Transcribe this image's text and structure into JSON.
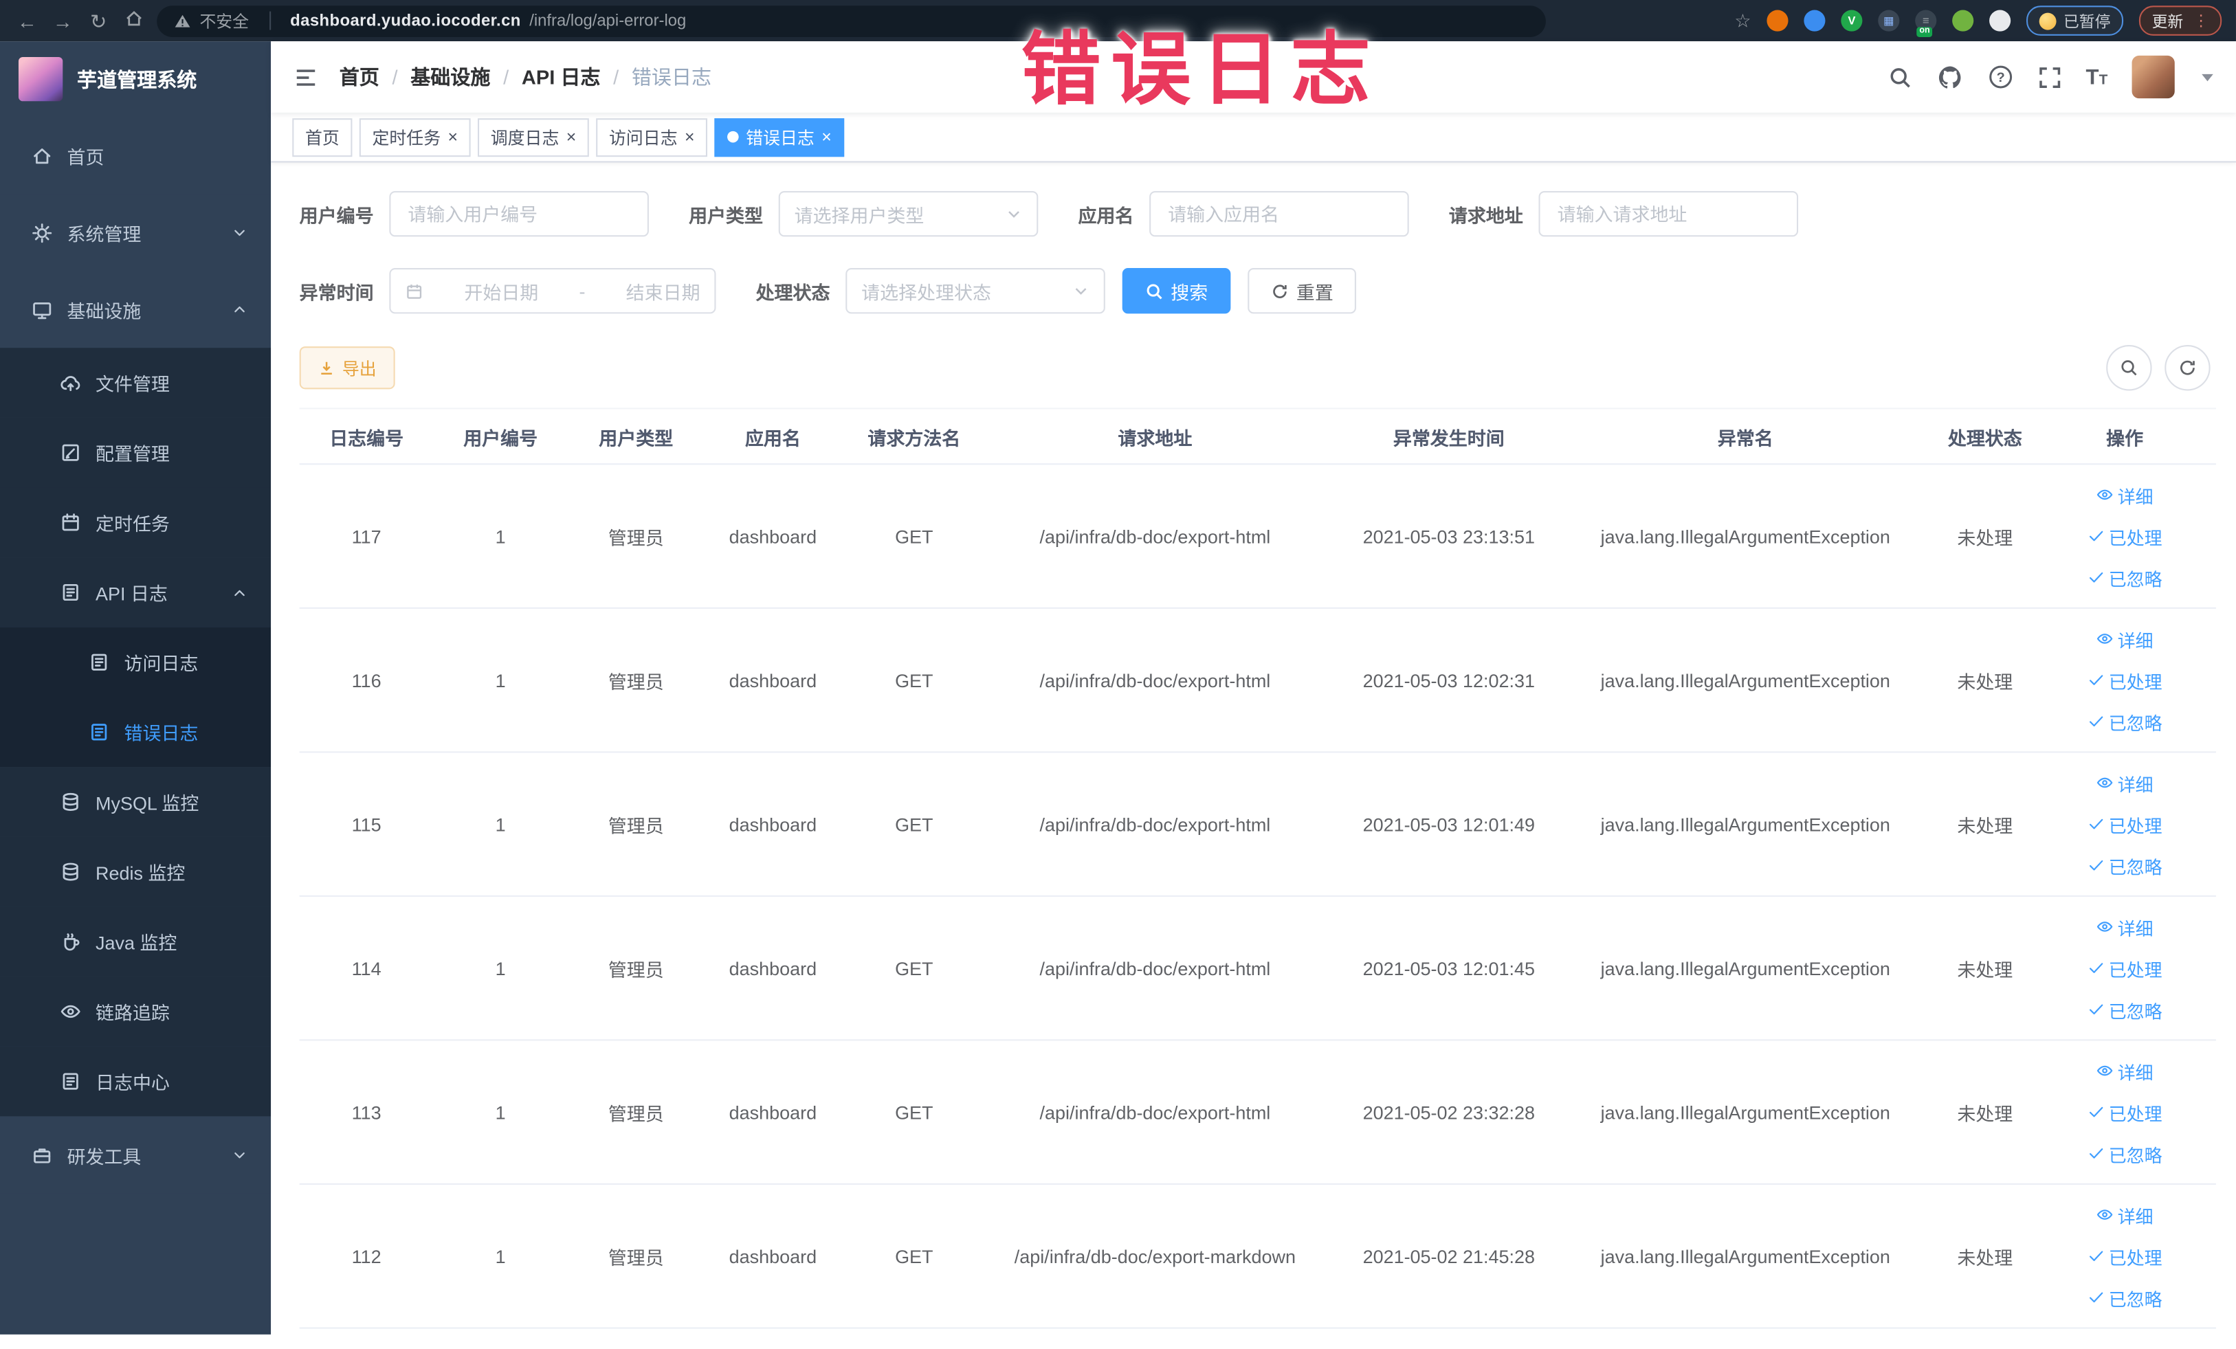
{
  "browser": {
    "security_label": "不安全",
    "url_host": "dashboard.yudao.iocoder.cn",
    "url_path": "/infra/log/api-error-log",
    "paused_badge": "已暂停",
    "update_button": "更新",
    "extensions": [
      {
        "name": "extension-orange",
        "color": "#e8710a",
        "glyph": "",
        "glyph_color": ""
      },
      {
        "name": "extension-blue-shield",
        "color": "#3b8df0",
        "glyph": "",
        "glyph_color": ""
      },
      {
        "name": "extension-green-v",
        "color": "#21a84b",
        "glyph": "V",
        "glyph_color": "#ffffff"
      },
      {
        "name": "extension-grid",
        "color": "#3a4654",
        "glyph": "▦",
        "glyph_color": "#8ab4f8"
      },
      {
        "name": "extension-on-switch",
        "color": "#37434f",
        "glyph": "≡",
        "glyph_color": "#9aa0a6",
        "badge": "on"
      },
      {
        "name": "extension-sprout",
        "color": "#71b340",
        "glyph": "",
        "glyph_color": ""
      },
      {
        "name": "extension-puppet",
        "color": "#e8eaed",
        "glyph": "",
        "glyph_color": ""
      }
    ]
  },
  "overlay": {
    "text": "错误日志",
    "color": "#e9395d"
  },
  "sidebar": {
    "title": "芋道管理系统",
    "items": [
      {
        "label": "首页",
        "icon": "home",
        "level": 1
      },
      {
        "label": "系统管理",
        "icon": "gear",
        "level": 1,
        "chevron": "down"
      },
      {
        "label": "基础设施",
        "icon": "monitor",
        "level": 1,
        "chevron": "up"
      },
      {
        "label": "文件管理",
        "icon": "cloud",
        "level": 2
      },
      {
        "label": "配置管理",
        "icon": "edit",
        "level": 2
      },
      {
        "label": "定时任务",
        "icon": "timer",
        "level": 2
      },
      {
        "label": "API 日志",
        "icon": "log",
        "level": 2,
        "chevron": "up"
      },
      {
        "label": "访问日志",
        "icon": "log",
        "level": 3
      },
      {
        "label": "错误日志",
        "icon": "log",
        "level": 3,
        "active": true
      },
      {
        "label": "MySQL 监控",
        "icon": "db",
        "level": 2
      },
      {
        "label": "Redis 监控",
        "icon": "db",
        "level": 2
      },
      {
        "label": "Java 监控",
        "icon": "java",
        "level": 2
      },
      {
        "label": "链路追踪",
        "icon": "eye",
        "level": 2
      },
      {
        "label": "日志中心",
        "icon": "log",
        "level": 2
      },
      {
        "label": "研发工具",
        "icon": "tool",
        "level": 1,
        "chevron": "down"
      }
    ]
  },
  "header": {
    "breadcrumb": [
      "首页",
      "基础设施",
      "API 日志",
      "错误日志"
    ]
  },
  "tabs": [
    {
      "label": "首页",
      "closable": false,
      "active": false
    },
    {
      "label": "定时任务",
      "closable": true,
      "active": false
    },
    {
      "label": "调度日志",
      "closable": true,
      "active": false
    },
    {
      "label": "访问日志",
      "closable": true,
      "active": false
    },
    {
      "label": "错误日志",
      "closable": true,
      "active": true
    }
  ],
  "filters": {
    "user_id": {
      "label": "用户编号",
      "placeholder": "请输入用户编号"
    },
    "user_type": {
      "label": "用户类型",
      "placeholder": "请选择用户类型"
    },
    "app_name": {
      "label": "应用名",
      "placeholder": "请输入应用名"
    },
    "request_url": {
      "label": "请求地址",
      "placeholder": "请输入请求地址"
    },
    "exception_time": {
      "label": "异常时间",
      "start_placeholder": "开始日期",
      "separator": "-",
      "end_placeholder": "结束日期"
    },
    "process_status": {
      "label": "处理状态",
      "placeholder": "请选择处理状态"
    },
    "search_label": "搜索",
    "reset_label": "重置"
  },
  "toolbar": {
    "export_label": "导出"
  },
  "table": {
    "columns": [
      "日志编号",
      "用户编号",
      "用户类型",
      "应用名",
      "请求方法名",
      "请求地址",
      "异常发生时间",
      "异常名",
      "处理状态",
      "操作"
    ],
    "row_actions": [
      {
        "label": "详细",
        "icon": "eye"
      },
      {
        "label": "已处理",
        "icon": "check"
      },
      {
        "label": "已忽略",
        "icon": "check"
      }
    ],
    "rows": [
      {
        "id": "117",
        "user_id": "1",
        "user_type": "管理员",
        "app": "dashboard",
        "method": "GET",
        "url": "/api/infra/db-doc/export-html",
        "time": "2021-05-03 23:13:51",
        "exception": "java.lang.IllegalArgumentException",
        "status": "未处理"
      },
      {
        "id": "116",
        "user_id": "1",
        "user_type": "管理员",
        "app": "dashboard",
        "method": "GET",
        "url": "/api/infra/db-doc/export-html",
        "time": "2021-05-03 12:02:31",
        "exception": "java.lang.IllegalArgumentException",
        "status": "未处理"
      },
      {
        "id": "115",
        "user_id": "1",
        "user_type": "管理员",
        "app": "dashboard",
        "method": "GET",
        "url": "/api/infra/db-doc/export-html",
        "time": "2021-05-03 12:01:49",
        "exception": "java.lang.IllegalArgumentException",
        "status": "未处理"
      },
      {
        "id": "114",
        "user_id": "1",
        "user_type": "管理员",
        "app": "dashboard",
        "method": "GET",
        "url": "/api/infra/db-doc/export-html",
        "time": "2021-05-03 12:01:45",
        "exception": "java.lang.IllegalArgumentException",
        "status": "未处理"
      },
      {
        "id": "113",
        "user_id": "1",
        "user_type": "管理员",
        "app": "dashboard",
        "method": "GET",
        "url": "/api/infra/db-doc/export-html",
        "time": "2021-05-02 23:32:28",
        "exception": "java.lang.IllegalArgumentException",
        "status": "未处理"
      },
      {
        "id": "112",
        "user_id": "1",
        "user_type": "管理员",
        "app": "dashboard",
        "method": "GET",
        "url": "/api/infra/db-doc/export-markdown",
        "time": "2021-05-02 21:45:28",
        "exception": "java.lang.IllegalArgumentException",
        "status": "未处理"
      }
    ]
  },
  "colors": {
    "accent": "#409eff",
    "warning": "#e6a23c",
    "sidebar_bg": "#304156",
    "submenu_bg": "#1f2d3d"
  }
}
